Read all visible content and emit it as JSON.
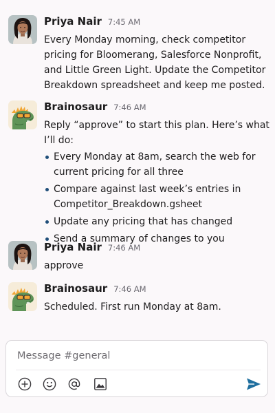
{
  "messages": [
    {
      "author": "Priya Nair",
      "time": "7:45 AM",
      "avatar": "priya-avatar",
      "text": "Every Monday morning, check competitor pricing for Bloomerang, Salesforce Nonprofit, and Little Green Light. Update the Competitor Breakdown spreadsheet and keep me posted."
    },
    {
      "author": "Brainosaur",
      "time": "7:46 AM",
      "avatar": "dinosaur-avatar",
      "text": "Reply “approve” to start this plan. Here’s what I’ll do:",
      "bullets": [
        "Every Monday at 8am, search the web for current pricing for all three",
        "Compare against last week’s entries in Competitor_Breakdown.gsheet",
        "Update any pricing that has changed",
        "Send a summary of changes to you"
      ]
    },
    {
      "author": "Priya Nair",
      "time": "7:46 AM",
      "avatar": "priya-avatar",
      "text": "approve"
    },
    {
      "author": "Brainosaur",
      "time": "7:46 AM",
      "avatar": "dinosaur-avatar",
      "text": "Scheduled. First run Monday at 8am."
    }
  ],
  "composer": {
    "placeholder": "Message #general",
    "tools": [
      "add-icon",
      "emoji-icon",
      "mention-icon",
      "image-icon"
    ],
    "send_icon": "send-icon"
  },
  "colors": {
    "background": "#fbf8fa",
    "bullet": "#1f4e79",
    "send": "#1f6f9f"
  }
}
